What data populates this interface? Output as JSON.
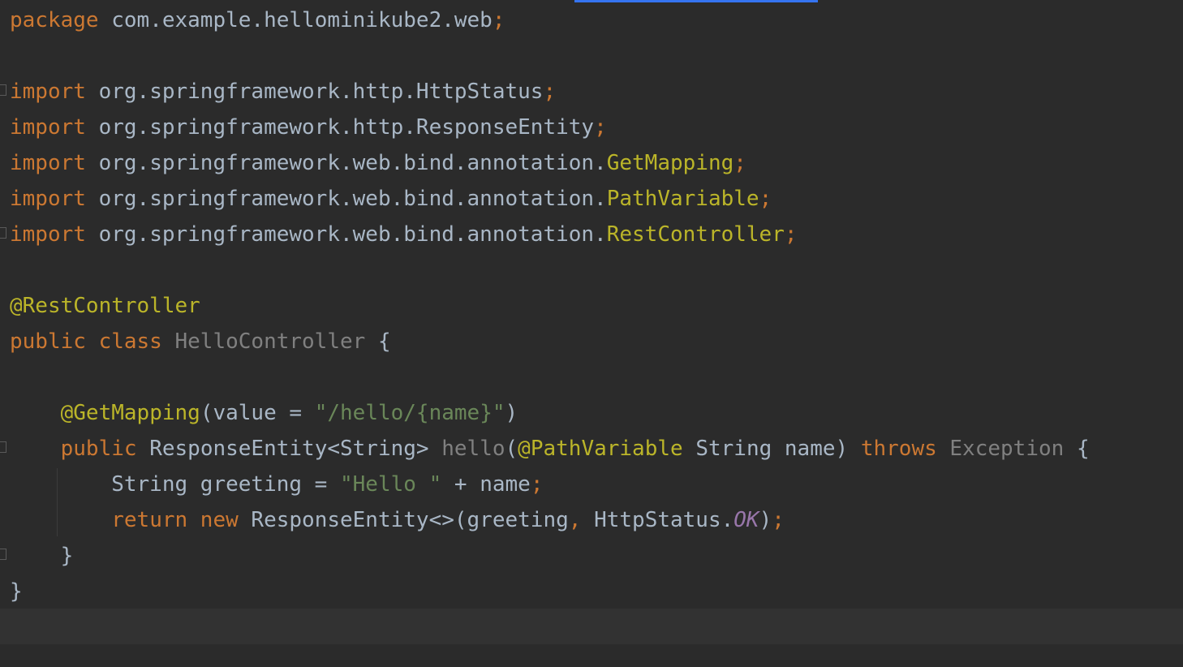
{
  "lines": [
    [
      {
        "t": "package ",
        "c": "kw"
      },
      {
        "t": "com.example.hellominikube2.web",
        "c": ""
      },
      {
        "t": ";",
        "c": "kw"
      }
    ],
    [],
    [
      {
        "t": "import ",
        "c": "kw"
      },
      {
        "t": "org.springframework.http.HttpStatus",
        "c": ""
      },
      {
        "t": ";",
        "c": "kw"
      }
    ],
    [
      {
        "t": "import ",
        "c": "kw"
      },
      {
        "t": "org.springframework.http.ResponseEntity",
        "c": ""
      },
      {
        "t": ";",
        "c": "kw"
      }
    ],
    [
      {
        "t": "import ",
        "c": "kw"
      },
      {
        "t": "org.springframework.web.bind.annotation.",
        "c": ""
      },
      {
        "t": "GetMapping",
        "c": "ann"
      },
      {
        "t": ";",
        "c": "kw"
      }
    ],
    [
      {
        "t": "import ",
        "c": "kw"
      },
      {
        "t": "org.springframework.web.bind.annotation.",
        "c": ""
      },
      {
        "t": "PathVariable",
        "c": "ann"
      },
      {
        "t": ";",
        "c": "kw"
      }
    ],
    [
      {
        "t": "import ",
        "c": "kw"
      },
      {
        "t": "org.springframework.web.bind.annotation.",
        "c": ""
      },
      {
        "t": "RestController",
        "c": "ann"
      },
      {
        "t": ";",
        "c": "kw"
      }
    ],
    [],
    [
      {
        "t": "@RestController",
        "c": "ann"
      }
    ],
    [
      {
        "t": "public class ",
        "c": "kw"
      },
      {
        "t": "HelloController",
        "c": "gray"
      },
      {
        "t": " {",
        "c": ""
      }
    ],
    [],
    [
      {
        "t": "    ",
        "c": ""
      },
      {
        "t": "@GetMapping",
        "c": "ann"
      },
      {
        "t": "(value = ",
        "c": ""
      },
      {
        "t": "\"/hello/{name}\"",
        "c": "str"
      },
      {
        "t": ")",
        "c": ""
      }
    ],
    [
      {
        "t": "    ",
        "c": ""
      },
      {
        "t": "public ",
        "c": "kw"
      },
      {
        "t": "ResponseEntity<String> ",
        "c": ""
      },
      {
        "t": "hello",
        "c": "gray"
      },
      {
        "t": "(",
        "c": ""
      },
      {
        "t": "@PathVariable",
        "c": "ann"
      },
      {
        "t": " String name) ",
        "c": ""
      },
      {
        "t": "throws ",
        "c": "kw"
      },
      {
        "t": "Exception",
        "c": "gray"
      },
      {
        "t": " {",
        "c": ""
      }
    ],
    [
      {
        "t": "        String greeting = ",
        "c": ""
      },
      {
        "t": "\"Hello \"",
        "c": "str"
      },
      {
        "t": " + name",
        "c": ""
      },
      {
        "t": ";",
        "c": "kw"
      }
    ],
    [
      {
        "t": "        ",
        "c": ""
      },
      {
        "t": "return new ",
        "c": "kw"
      },
      {
        "t": "ResponseEntity<>(greeting",
        "c": ""
      },
      {
        "t": ", ",
        "c": "kw"
      },
      {
        "t": "HttpStatus.",
        "c": ""
      },
      {
        "t": "OK",
        "c": "const"
      },
      {
        "t": ")",
        "c": ""
      },
      {
        "t": ";",
        "c": "kw"
      }
    ],
    [
      {
        "t": "    }",
        "c": ""
      }
    ],
    [
      {
        "t": "}",
        "c": ""
      }
    ],
    []
  ]
}
